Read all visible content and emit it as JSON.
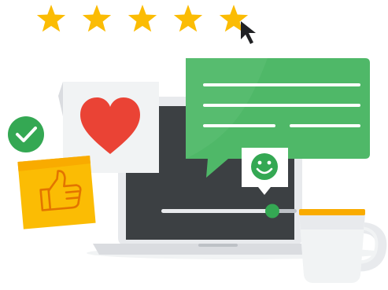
{
  "rating": {
    "stars_filled": 5,
    "stars_total": 5
  },
  "icons": {
    "stars": "star-icon",
    "cursor": "mouse-pointer-icon",
    "check": "check-circle-icon",
    "heart": "heart-icon",
    "thumb": "thumbs-up-icon",
    "chat": "chat-bubble-icon",
    "smiley": "smiley-icon",
    "laptop": "laptop-icon",
    "mug": "coffee-mug-icon"
  },
  "player": {
    "progress_fraction": 0.82
  },
  "colors": {
    "star": "#fbbc04",
    "green": "#34a853",
    "chat_green": "#4fb868",
    "heart_red": "#ea4335",
    "sticky_yellow": "#fbbc04",
    "screen_dark": "#3c4043",
    "laptop_gray": "#dadce0",
    "mug_rim": "#f9ab00"
  }
}
